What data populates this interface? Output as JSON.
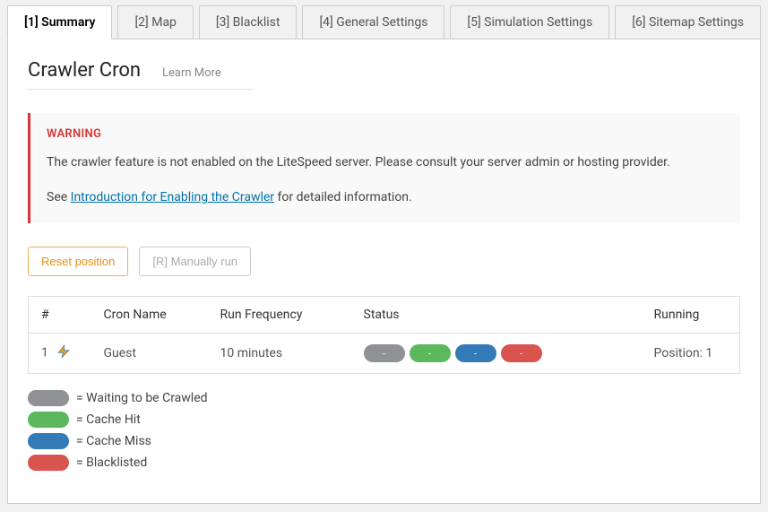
{
  "tabs": [
    {
      "label": "[1] Summary"
    },
    {
      "label": "[2] Map"
    },
    {
      "label": "[3] Blacklist"
    },
    {
      "label": "[4] General Settings"
    },
    {
      "label": "[5] Simulation Settings"
    },
    {
      "label": "[6] Sitemap Settings"
    }
  ],
  "title": "Crawler Cron",
  "learn_more": "Learn More",
  "warning": {
    "heading": "WARNING",
    "line1": "The crawler feature is not enabled on the LiteSpeed server. Please consult your server admin or hosting provider.",
    "line2_prefix": "See ",
    "line2_link": "Introduction for Enabling the Crawler",
    "line2_suffix": " for detailed information."
  },
  "buttons": {
    "reset": "Reset position",
    "manual": "[R] Manually run"
  },
  "table": {
    "headers": {
      "num": "#",
      "name": "Cron Name",
      "freq": "Run Frequency",
      "status": "Status",
      "running": "Running"
    },
    "row": {
      "num": "1",
      "name": "Guest",
      "freq": "10 minutes",
      "pill_dash": "-",
      "running": "Position: 1"
    }
  },
  "legend": {
    "waiting": " = Waiting to be Crawled",
    "hit": " = Cache Hit",
    "miss": " = Cache Miss",
    "black": " = Blacklisted"
  },
  "colors": {
    "gray": "#8f9194",
    "green": "#5cb85c",
    "blue": "#337ab7",
    "red": "#d9534f"
  }
}
